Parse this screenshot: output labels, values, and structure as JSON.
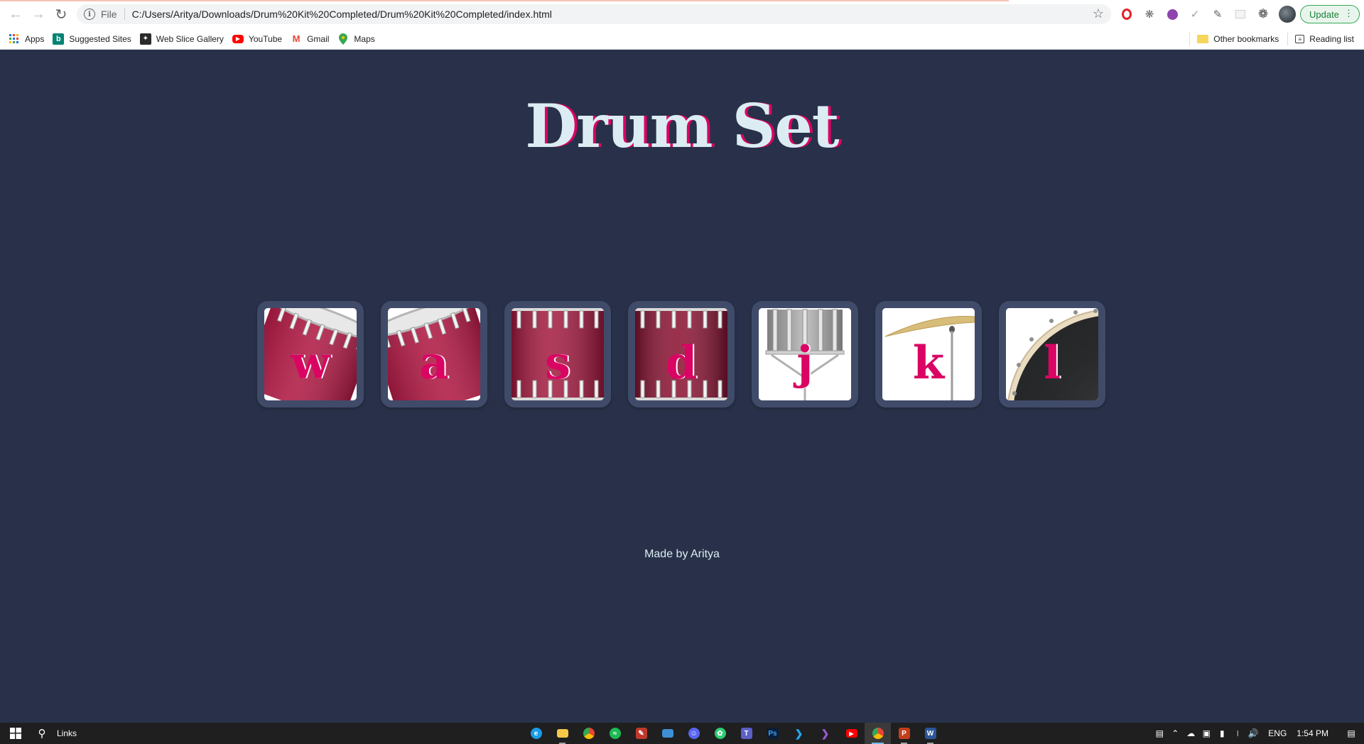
{
  "browser": {
    "address": {
      "scheme_label": "File",
      "url": "C:/Users/Aritya/Downloads/Drum%20Kit%20Completed/Drum%20Kit%20Completed/index.html"
    },
    "update_button": "Update"
  },
  "bookmarks": {
    "items": [
      {
        "label": "Apps",
        "icon": "apps-grid-icon"
      },
      {
        "label": "Suggested Sites",
        "icon": "bing-icon"
      },
      {
        "label": "Web Slice Gallery",
        "icon": "web-slice-icon"
      },
      {
        "label": "YouTube",
        "icon": "youtube-icon"
      },
      {
        "label": "Gmail",
        "icon": "gmail-icon"
      },
      {
        "label": "Maps",
        "icon": "maps-pin-icon"
      }
    ],
    "other": "Other bookmarks",
    "reading_list": "Reading list"
  },
  "page": {
    "title": "Drum Set",
    "drums": [
      {
        "key": "w",
        "instrument": "tom"
      },
      {
        "key": "a",
        "instrument": "tom"
      },
      {
        "key": "s",
        "instrument": "tom"
      },
      {
        "key": "d",
        "instrument": "tom"
      },
      {
        "key": "j",
        "instrument": "snare"
      },
      {
        "key": "k",
        "instrument": "crash"
      },
      {
        "key": "l",
        "instrument": "kick"
      }
    ],
    "footer": "Made by Aritya"
  },
  "taskbar": {
    "search_label": "Links",
    "language": "ENG",
    "time": "1:54 PM"
  },
  "colors": {
    "page_background": "#283149",
    "drum_border": "#404b69",
    "title_text": "#dbedf3",
    "accent_pink": "#da0463"
  }
}
